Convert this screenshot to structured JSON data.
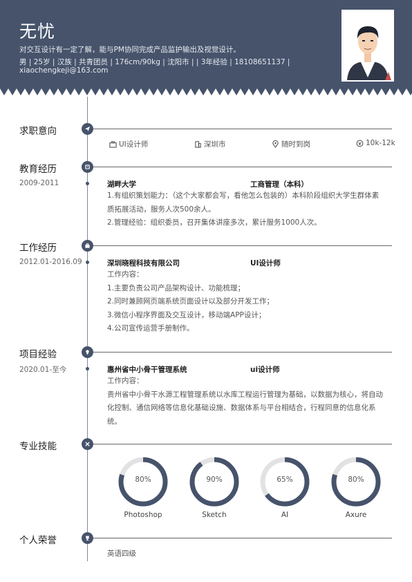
{
  "header": {
    "name": "无忧",
    "summary": "对交互设计有一定了解，能与PM协同完成产品监护输出及视觉设计。",
    "info": "男 | 25岁 | 汉族 | 共青团员 | 176cm/90kg | 沈阳市 | | 3年经验 | 18108651137 |",
    "email": "xiaochengkeji@163.com"
  },
  "sections": {
    "intent": {
      "title": "求职意向",
      "position": "UI设计师",
      "city": "深圳市",
      "availability": "随时到岗",
      "salary": "10k-12k"
    },
    "education": {
      "title": "教育经历",
      "date": "2009-2011",
      "school": "湖畔大学",
      "major": "工商管理（本科）",
      "lines": [
        "1.有组织策划能力：（这个大家都会写，看他怎么包装的）本科阶段组织大学生群体素",
        "质拓展活动，服务人次500余人。",
        "2.管理经验：组织委员，召开集体讲座多次，累计服务1000人次。"
      ]
    },
    "work": {
      "title": "工作经历",
      "date": "2012.01-2016.09",
      "company": "深圳晓程科技有限公司",
      "role": "UI设计师",
      "lines": [
        "工作内容：",
        "1.主要负责公司产品架构设计、功能梳理；",
        "2.同时兼顾网页端系统页面设计以及部分开发工作；",
        "3.微信小程序界面及交互设计，移动端APP设计；",
        "4.公司宣传运营手册制作。"
      ]
    },
    "project": {
      "title": "项目经验",
      "date": "2020.01-至今",
      "name": "惠州省中小骨干管理系统",
      "role": "ui设计师",
      "lines": [
        "工作内容：",
        "贵州省中小骨干水源工程管理系统以水库工程运行管理为基础，以数据为核心，将自动",
        "化控制、通信网络等信息化基础设施、数据体系与平台相结合，行程同意的信息化系",
        "统。"
      ]
    },
    "skills": {
      "title": "专业技能",
      "items": [
        {
          "name": "Photoshop",
          "label": "80%",
          "value": 80
        },
        {
          "name": "Sketch",
          "label": "90%",
          "value": 90
        },
        {
          "name": "AI",
          "label": "65%",
          "value": 65
        },
        {
          "name": "Axure",
          "label": "80%",
          "value": 80
        }
      ]
    },
    "honors": {
      "title": "个人荣誉",
      "item": "英语四级"
    }
  },
  "colors": {
    "header_bg": "#46536b",
    "ring_fill": "#46536b",
    "ring_track": "#e2e2e2"
  }
}
